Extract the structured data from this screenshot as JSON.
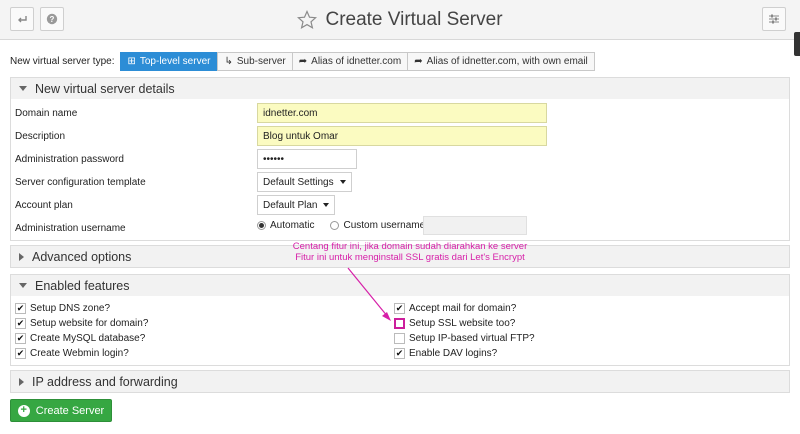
{
  "header": {
    "title": "Create Virtual Server",
    "back_icon": "back-arrow-icon",
    "help_icon": "question-icon",
    "star_icon": "star-icon",
    "settings_icon": "settings-sliders-icon"
  },
  "server_type": {
    "label": "New virtual server type:",
    "options": [
      {
        "label": "Top-level server",
        "icon": "plus-square-icon",
        "active": true
      },
      {
        "label": "Sub-server",
        "icon": "sub-arrow-icon"
      },
      {
        "label": "Alias of idnetter.com",
        "icon": "share-icon"
      },
      {
        "label": "Alias of idnetter.com, with own email",
        "icon": "share-icon"
      }
    ]
  },
  "details": {
    "title": "New virtual server details",
    "domain_label": "Domain name",
    "domain_value": "idnetter.com",
    "description_label": "Description",
    "description_value": "Blog untuk Omar",
    "password_label": "Administration password",
    "password_value": "••••••",
    "template_label": "Server configuration template",
    "template_value": "Default Settings",
    "plan_label": "Account plan",
    "plan_value": "Default Plan",
    "username_label": "Administration username",
    "username_auto": "Automatic",
    "username_custom": "Custom username"
  },
  "advanced": {
    "title": "Advanced options"
  },
  "features": {
    "title": "Enabled features",
    "left": [
      {
        "label": "Setup DNS zone?",
        "checked": true
      },
      {
        "label": "Setup website for domain?",
        "checked": true
      },
      {
        "label": "Create MySQL database?",
        "checked": true
      },
      {
        "label": "Create Webmin login?",
        "checked": true
      }
    ],
    "right": [
      {
        "label": "Accept mail for domain?",
        "checked": true
      },
      {
        "label": "Setup SSL website too?",
        "checked": false
      },
      {
        "label": "Setup IP-based virtual FTP?",
        "checked": false
      },
      {
        "label": "Enable DAV logins?",
        "checked": true
      }
    ]
  },
  "annotation": {
    "line1": "Centang fitur ini, jika domain sudah diarahkan ke server",
    "line2": "Fitur ini untuk menginstall SSL gratis dari Let's Encrypt",
    "color": "#d61fa8"
  },
  "ip": {
    "title": "IP address and forwarding"
  },
  "create_button": {
    "label": "Create Server",
    "color": "#36a742"
  }
}
